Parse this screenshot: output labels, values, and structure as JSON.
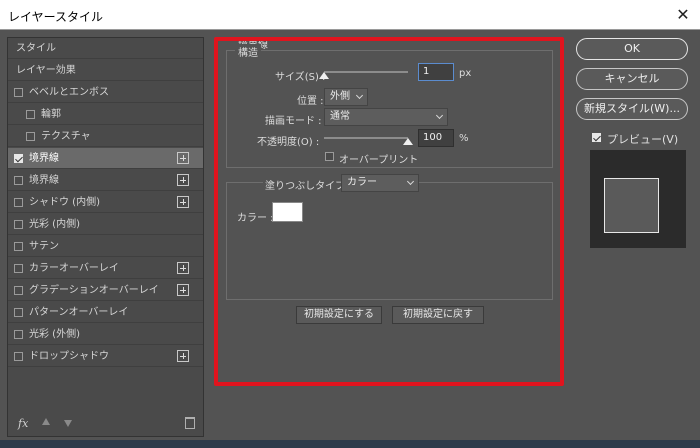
{
  "window": {
    "title": "レイヤースタイル",
    "close_icon": "close-icon"
  },
  "sidebar": {
    "items": [
      {
        "label": "スタイル",
        "checkbox": false,
        "checked": false,
        "indent": 0,
        "plus": false,
        "active": false
      },
      {
        "label": "レイヤー効果",
        "checkbox": false,
        "checked": false,
        "indent": 0,
        "plus": false,
        "active": false
      },
      {
        "label": "ベベルとエンボス",
        "checkbox": true,
        "checked": false,
        "indent": 0,
        "plus": false,
        "active": false
      },
      {
        "label": "輪郭",
        "checkbox": true,
        "checked": false,
        "indent": 1,
        "plus": false,
        "active": false
      },
      {
        "label": "テクスチャ",
        "checkbox": true,
        "checked": false,
        "indent": 1,
        "plus": false,
        "active": false
      },
      {
        "label": "境界線",
        "checkbox": true,
        "checked": true,
        "indent": 0,
        "plus": true,
        "active": true
      },
      {
        "label": "境界線",
        "checkbox": true,
        "checked": false,
        "indent": 0,
        "plus": true,
        "active": false
      },
      {
        "label": "シャドウ (内側)",
        "checkbox": true,
        "checked": false,
        "indent": 0,
        "plus": true,
        "active": false
      },
      {
        "label": "光彩 (内側)",
        "checkbox": true,
        "checked": false,
        "indent": 0,
        "plus": false,
        "active": false
      },
      {
        "label": "サテン",
        "checkbox": true,
        "checked": false,
        "indent": 0,
        "plus": false,
        "active": false
      },
      {
        "label": "カラーオーバーレイ",
        "checkbox": true,
        "checked": false,
        "indent": 0,
        "plus": true,
        "active": false
      },
      {
        "label": "グラデーションオーバーレイ",
        "checkbox": true,
        "checked": false,
        "indent": 0,
        "plus": true,
        "active": false
      },
      {
        "label": "パターンオーバーレイ",
        "checkbox": true,
        "checked": false,
        "indent": 0,
        "plus": false,
        "active": false
      },
      {
        "label": "光彩 (外側)",
        "checkbox": true,
        "checked": false,
        "indent": 0,
        "plus": false,
        "active": false
      },
      {
        "label": "ドロップシャドウ",
        "checkbox": true,
        "checked": false,
        "indent": 0,
        "plus": true,
        "active": false
      }
    ],
    "footer": {
      "fx_label": "fx"
    }
  },
  "stroke": {
    "section_title": "境界線",
    "structure_title": "構造",
    "size_label": "サイズ(S) :",
    "size_value": "1",
    "size_unit": "px",
    "size_slider_fraction": 0.0,
    "position_label": "位置 :",
    "position_value": "外側",
    "blend_label": "描画モード :",
    "blend_value": "通常",
    "opacity_label": "不透明度(O) :",
    "opacity_value": "100",
    "opacity_unit": "%",
    "opacity_slider_fraction": 1.0,
    "overprint_label": "オーバープリント",
    "overprint_checked": false,
    "fill_type_label": "塗りつぶしタイプ :",
    "fill_type_value": "カラー",
    "color_label": "カラー :",
    "color_value": "#ffffff",
    "make_default_label": "初期設定にする",
    "reset_default_label": "初期設定に戻す"
  },
  "actions": {
    "ok_label": "OK",
    "cancel_label": "キャンセル",
    "new_style_label": "新規スタイル(W)...",
    "preview_label": "プレビュー(V)",
    "preview_checked": true
  },
  "colors": {
    "highlight_box": "#e0141e",
    "dialog_bg": "#535353"
  }
}
